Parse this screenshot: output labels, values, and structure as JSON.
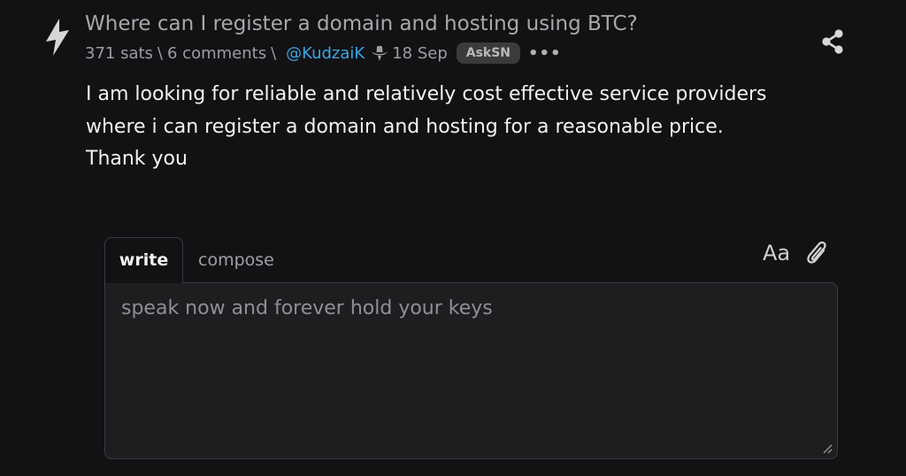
{
  "post": {
    "title": "Where can I register a domain and hosting using BTC?",
    "sats": "371 sats",
    "separator": "\\",
    "comments": "6 comments",
    "author": "@KudzaiK",
    "date": "18 Sep",
    "territory": "AskSN",
    "more_label": "•••",
    "body": [
      "I am looking for reliable and relatively cost effective service providers",
      "where i can register a domain and hosting for a reasonable price.",
      "Thank you"
    ]
  },
  "reply": {
    "tab_write": "write",
    "tab_compose": "compose",
    "format_label": "Aa",
    "placeholder": "speak now and forever hold your keys",
    "value": ""
  },
  "icons": {
    "zap": "lightning-bolt-icon",
    "hat": "cowboy-hat-icon",
    "share": "share-icon",
    "attach": "paperclip-icon",
    "resize": "resize-grip-icon"
  },
  "colors": {
    "background": "#121214",
    "link": "#3aa7e8",
    "muted": "#9c9ea1",
    "tag_bg": "#3a3b3d"
  }
}
